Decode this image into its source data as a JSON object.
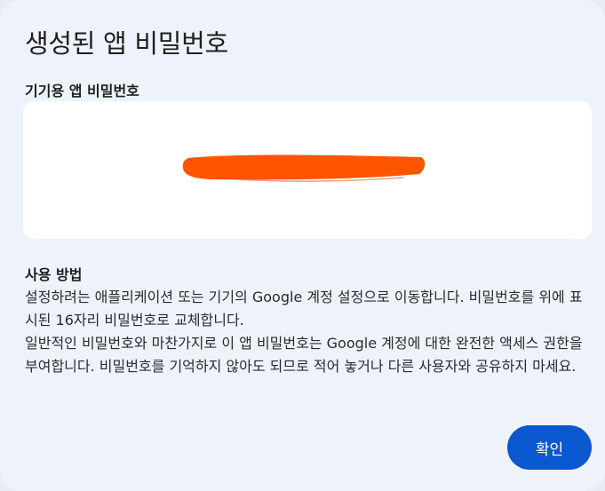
{
  "dialog": {
    "title": "생성된 앱 비밀번호",
    "password_label": "기기용 앱 비밀번호",
    "password_value_redacted": true,
    "redaction_color": "#ff5500",
    "how_to": {
      "heading": "사용 방법",
      "paragraph_1": "설정하려는 애플리케이션 또는 기기의 Google 계정 설정으로 이동합니다. 비밀번호를 위에 표시된 16자리 비밀번호로 교체합니다.",
      "paragraph_2": "일반적인 비밀번호와 마찬가지로 이 앱 비밀번호는 Google 계정에 대한 완전한 액세스 권한을 부여합니다. 비밀번호를 기억하지 않아도 되므로 적어 놓거나 다른 사용자와 공유하지 마세요."
    },
    "confirm_label": "확인",
    "accent_color": "#0b57d0"
  }
}
